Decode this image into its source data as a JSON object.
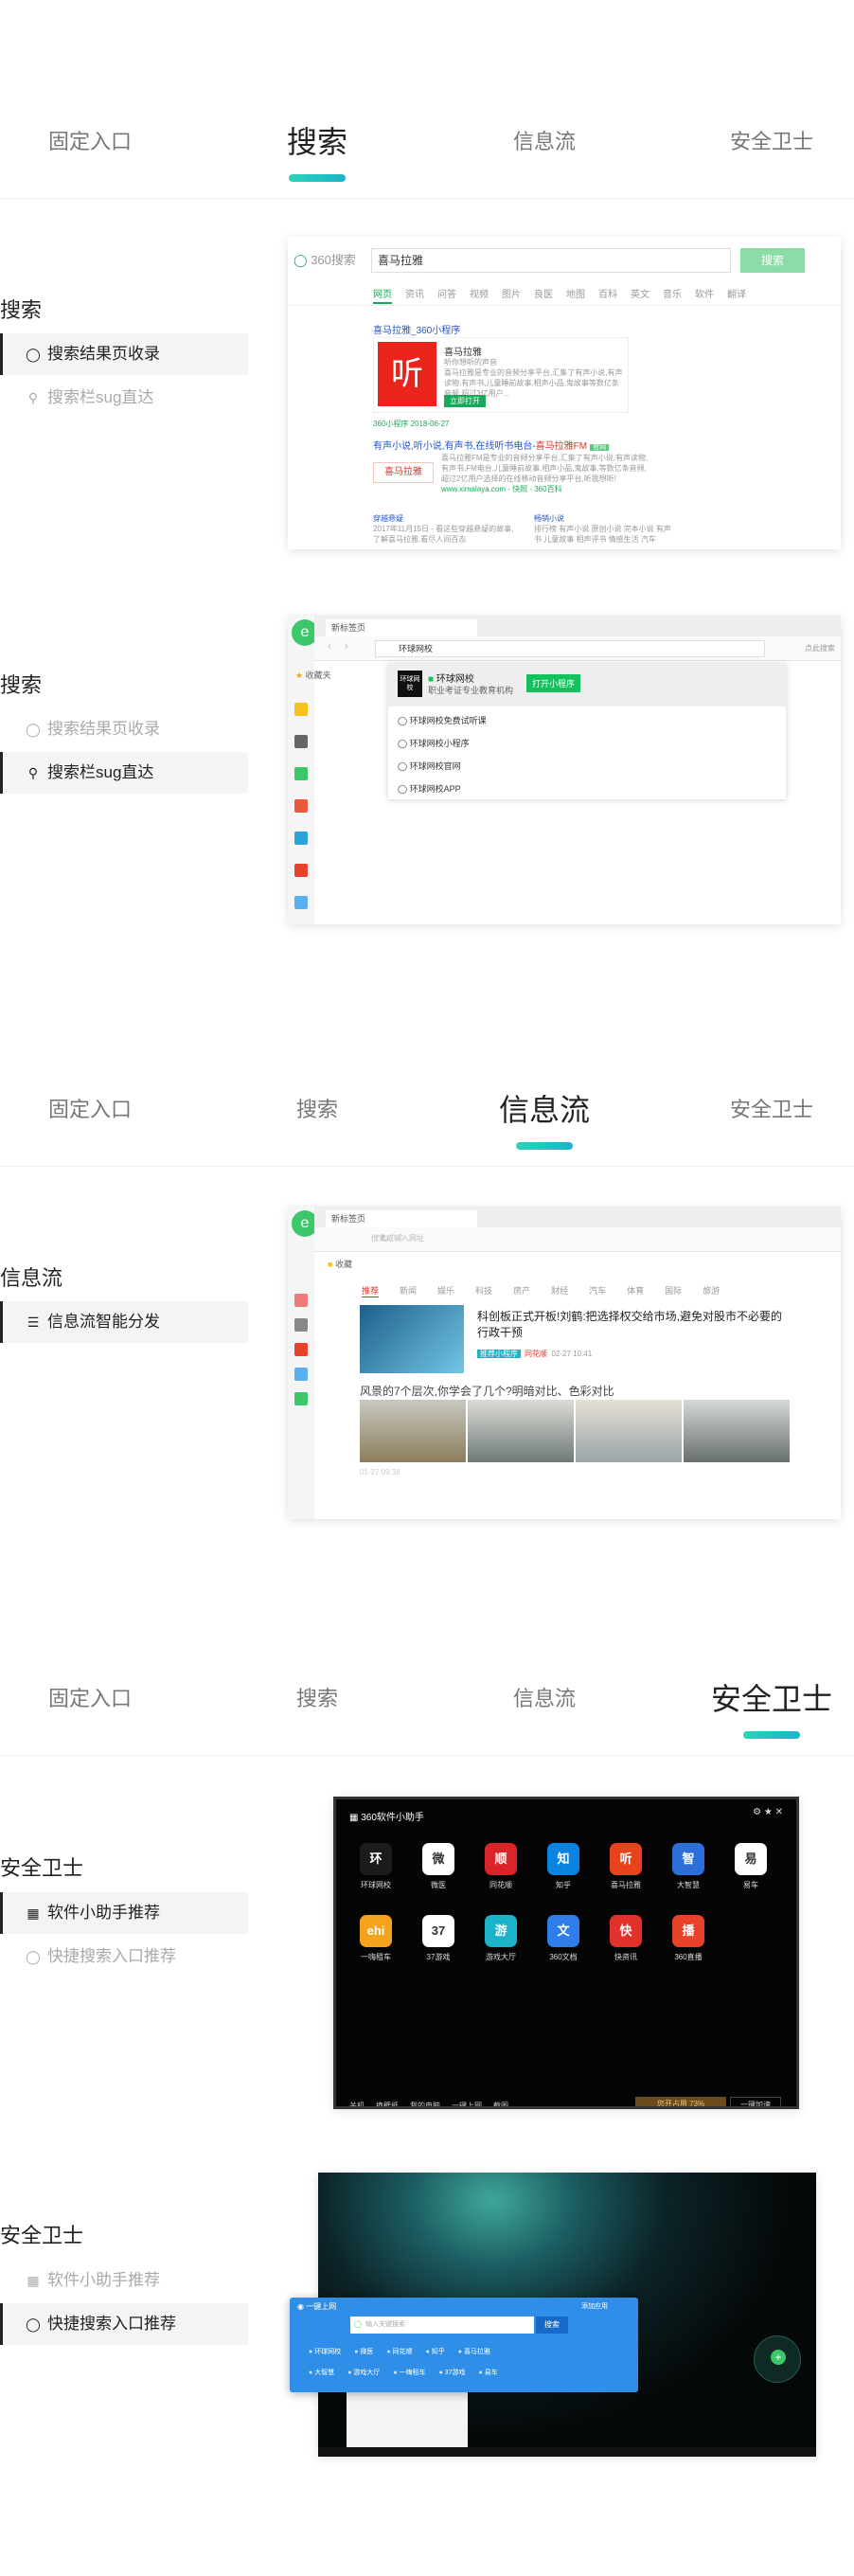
{
  "tabs": [
    "固定入口",
    "搜索",
    "信息流",
    "安全卫士"
  ],
  "sections": [
    {
      "title": "搜索",
      "items": [
        {
          "icon": "search-icon",
          "label": "搜索结果页收录",
          "active": true
        },
        {
          "icon": "location-pin-icon",
          "label": "搜索栏sug直达",
          "active": false
        }
      ]
    },
    {
      "title": "搜索",
      "items": [
        {
          "icon": "search-icon",
          "label": "搜索结果页收录",
          "active": false
        },
        {
          "icon": "location-pin-icon",
          "label": "搜索栏sug直达",
          "active": true
        }
      ]
    },
    {
      "title": "信息流",
      "items": [
        {
          "icon": "feed-icon",
          "label": "信息流智能分发",
          "active": true
        }
      ]
    },
    {
      "title": "安全卫士",
      "items": [
        {
          "icon": "apps-icon",
          "label": "软件小助手推荐",
          "active": true
        },
        {
          "icon": "search-icon",
          "label": "快捷搜索入口推荐",
          "active": false
        }
      ]
    },
    {
      "title": "安全卫士",
      "items": [
        {
          "icon": "apps-icon",
          "label": "软件小助手推荐",
          "active": false
        },
        {
          "icon": "search-icon",
          "label": "快捷搜索入口推荐",
          "active": true
        }
      ]
    }
  ],
  "shot1": {
    "logo": "360搜索",
    "query": "喜马拉雅",
    "button": "搜索",
    "nav": [
      "网页",
      "资讯",
      "问答",
      "视频",
      "图片",
      "良医",
      "地图",
      "百科",
      "英文",
      "音乐",
      "软件",
      "翻译"
    ],
    "result_title": "喜马拉雅_360小程序",
    "card_logo": "听",
    "card_title": "喜马拉雅",
    "card_sub": "听你想听的声音",
    "card_desc": "喜马拉雅是专业的音频分享平台,汇集了有声小说,有声读物,有声书,儿童睡前故事,相声小品,鬼故事等数亿条音频,超过3亿用户...",
    "card_btn": "立即打开",
    "card_url": "360小程序 2018-06-27",
    "result2_a": "有声小说,听小说,有声书,在线听书电台-",
    "result2_b": "喜马拉雅FM",
    "result2_tag": "官网",
    "sub_logo": "喜马拉雅",
    "sub_desc": "喜马拉雅FM是专业的音频分享平台,汇集了有声小说,有声读物,有声书,FM电台,儿童睡前故事,相声小品,鬼故事,等数亿条音频,超过2亿用户选择的在线移动音频分享平台,听我想听!",
    "sub_url": "www.ximalaya.com - 快照 - 360百科",
    "col1_t": "穿越悬疑",
    "col1_d": "2017年11月15日 - 看这些穿越悬疑的故事,了解喜马拉雅,看尽人间百态",
    "col2_t": "畅销小说",
    "col2_d": "排行榜 有声小说 原创小说 完本小说 有声书 儿童故事 相声评书 情感生活 汽车"
  },
  "shot2": {
    "tab": "新标签页",
    "address": "环球网校",
    "right_hint": "点此搜索",
    "fav": "收藏夹",
    "top_logo": "环球网校",
    "top_name": "环球网校",
    "top_desc": "职业考证专业教育机构",
    "top_btn": "打开小程序",
    "suggestions": [
      "环球网校免费试听课",
      "环球网校小程序",
      "环球网校官网",
      "环球网校APP"
    ]
  },
  "shot3": {
    "tab": "新标签页",
    "address": "搜索或输入网址",
    "fav": "收藏",
    "nav": [
      "推荐",
      "新闻",
      "娱乐",
      "科技",
      "房产",
      "财经",
      "汽车",
      "体育",
      "国际",
      "旅游"
    ],
    "headline": "科创板正式开板!刘鹤:把选择权交给市场,避免对股市不必要的行政干预",
    "badge": "推荐小程序",
    "source": "同花顺",
    "time": "02-27  10:41",
    "headline2": "风景的7个层次,你学会了几个?明暗对比、色彩对比",
    "time2": "01-27  09:38"
  },
  "shot4": {
    "title": "360软件小助手",
    "apps_row1": [
      {
        "name": "环球网校",
        "glyph": "环",
        "color": "#1c1c1c"
      },
      {
        "name": "微医",
        "glyph": "微",
        "color": "#ffffff"
      },
      {
        "name": "同花顺",
        "glyph": "顺",
        "color": "#d9252a"
      },
      {
        "name": "知乎",
        "glyph": "知",
        "color": "#0a84e0"
      },
      {
        "name": "喜马拉雅",
        "glyph": "听",
        "color": "#e8431c"
      },
      {
        "name": "大智慧",
        "glyph": "智",
        "color": "#2c6fd8"
      },
      {
        "name": "易车",
        "glyph": "易",
        "color": "#ffffff"
      }
    ],
    "apps_row2": [
      {
        "name": "一嗨租车",
        "glyph": "ehi",
        "color": "#f5a21c"
      },
      {
        "name": "37游戏",
        "glyph": "37",
        "color": "#ffffff"
      },
      {
        "name": "游戏大厅",
        "glyph": "游",
        "color": "#1ab3c9"
      },
      {
        "name": "360文档",
        "glyph": "文",
        "color": "#2f7de8"
      },
      {
        "name": "快资讯",
        "glyph": "快",
        "color": "#e0322b"
      },
      {
        "name": "360直播",
        "glyph": "播",
        "color": "#e8432a"
      }
    ],
    "bottom": [
      "关机",
      "换壁纸",
      "我的电脑",
      "一键上网",
      "截图"
    ],
    "boost": "您开占用 73%",
    "boost_btn": "一键加速"
  },
  "shot5": {
    "panel_title": "一键上网",
    "panel_right": "添加应用",
    "input": "输入关键搜索",
    "btn": "搜索",
    "row1": [
      "环球网校",
      "微医",
      "同花顺",
      "知乎",
      "喜马拉雅"
    ],
    "row2": [
      "大智慧",
      "游戏大厅",
      "一嗨租车",
      "37游戏",
      "易车"
    ]
  }
}
